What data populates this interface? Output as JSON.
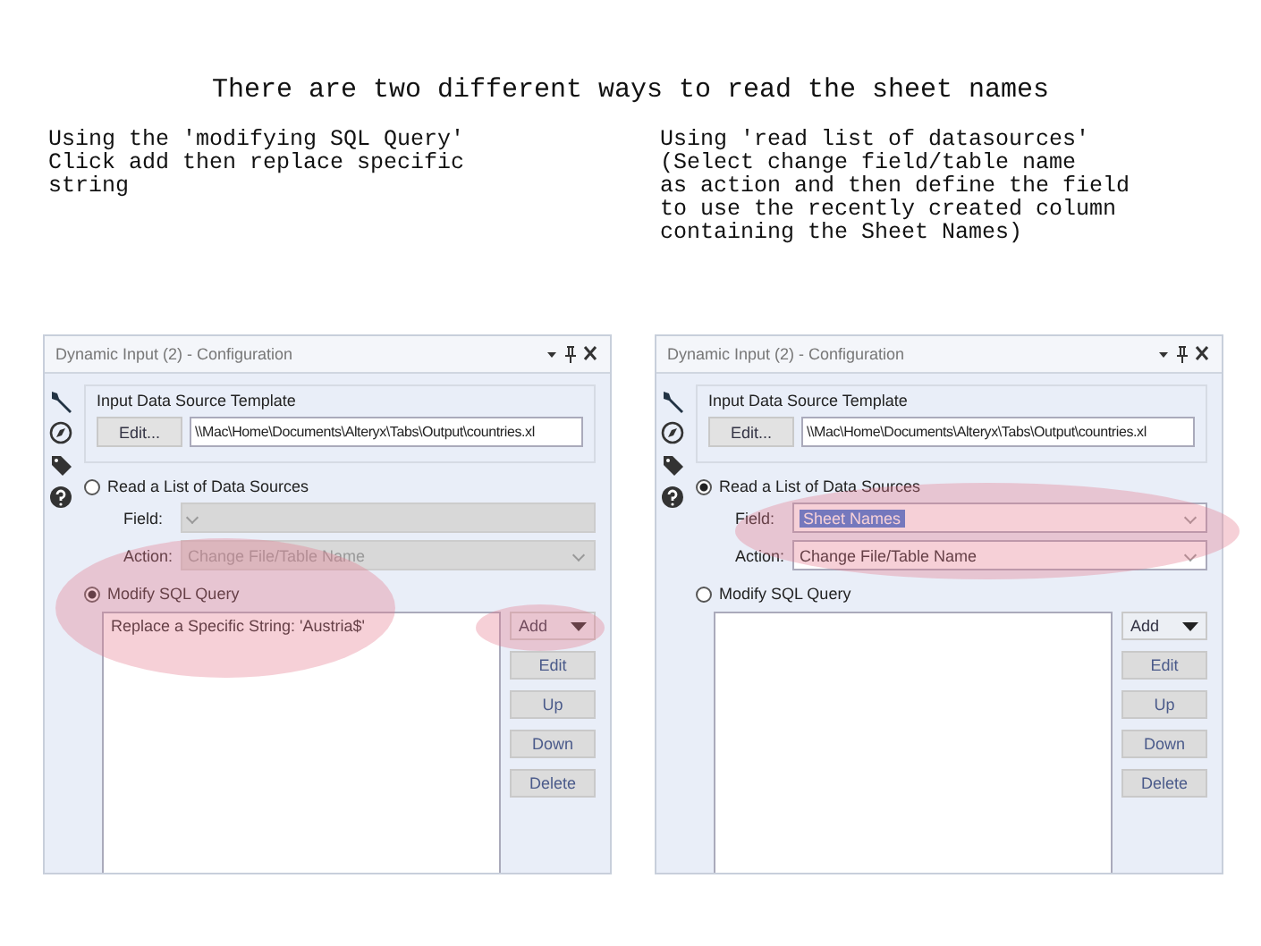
{
  "heading": "There are two different ways to read the sheet names",
  "examples": [
    {
      "caption": "Using the 'modifying SQL Query'\nClick add then replace specific\nstring",
      "panel": {
        "title": "Dynamic Input (2) - Configuration",
        "template_label": "Input Data Source Template",
        "edit_button": "Edit...",
        "path": "\\\\Mac\\Home\\Documents\\Alteryx\\Tabs\\Output\\countries.xl",
        "modes": [
          {
            "label": "Read a List of Data Sources",
            "selected": false
          },
          {
            "label": "Modify SQL Query",
            "selected": true
          }
        ],
        "field": {
          "label": "Field:",
          "disabled": true
        },
        "action": {
          "label": "Action:",
          "value": "Change File/Table Name",
          "disabled": true
        },
        "sql_items": [
          "Replace a Specific String: 'Austria$'"
        ],
        "buttons": [
          {
            "label": "Add",
            "kind": "dropdown"
          },
          {
            "label": "Edit",
            "kind": "plain"
          },
          {
            "label": "Up",
            "kind": "plain"
          },
          {
            "label": "Down",
            "kind": "plain"
          },
          {
            "label": "Delete",
            "kind": "plain"
          }
        ],
        "highlights": [
          {
            "kind": "sql_query"
          },
          {
            "kind": "add_button"
          }
        ]
      }
    },
    {
      "caption": "Using 'read list of datasources'\n(Select change field/table name\nas action and then define the field\nto use the recently created column\ncontaining the Sheet Names)",
      "panel": {
        "title": "Dynamic Input (2) - Configuration",
        "template_label": "Input Data Source Template",
        "edit_button": "Edit...",
        "path": "\\\\Mac\\Home\\Documents\\Alteryx\\Tabs\\Output\\countries.xl",
        "modes": [
          {
            "label": "Read a List of Data Sources",
            "selected": true
          },
          {
            "label": "Modify SQL Query",
            "selected": false
          }
        ],
        "field": {
          "label": "Field:",
          "value": "Sheet Names",
          "disabled": false
        },
        "action": {
          "label": "Action:",
          "value": "Change File/Table Name",
          "disabled": false
        },
        "buttons": [
          {
            "label": "Add",
            "kind": "dropdown"
          },
          {
            "label": "Edit",
            "kind": "plain"
          },
          {
            "label": "Up",
            "kind": "plain"
          },
          {
            "label": "Down",
            "kind": "plain"
          },
          {
            "label": "Delete",
            "kind": "plain"
          }
        ],
        "highlights": [
          {
            "kind": "list_fields"
          }
        ]
      }
    }
  ]
}
